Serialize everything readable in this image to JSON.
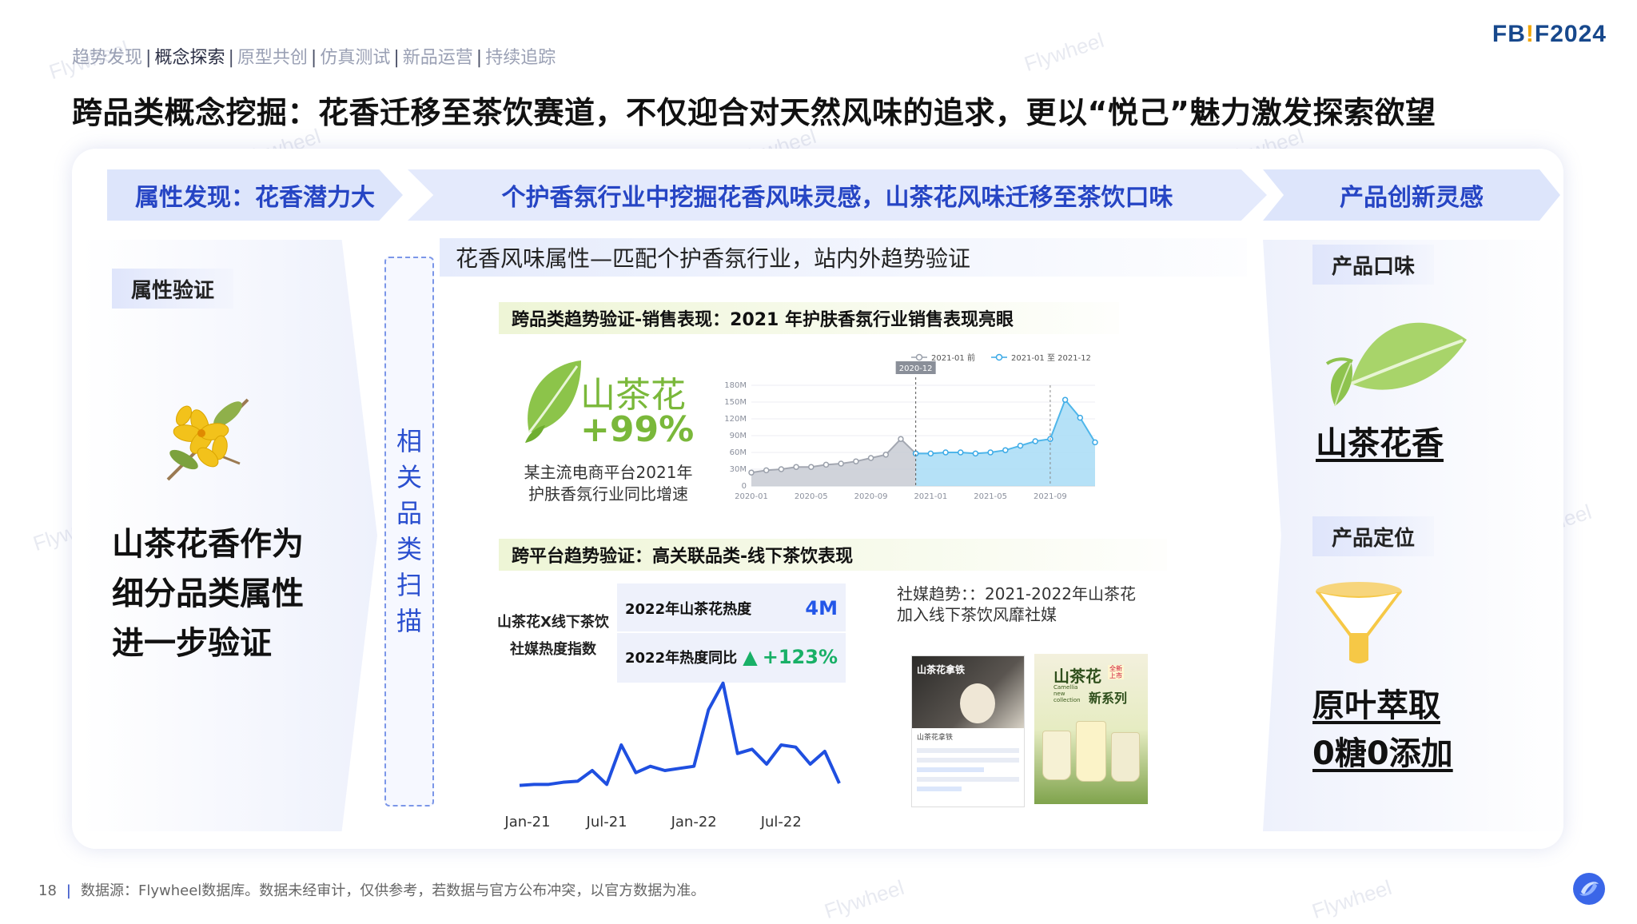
{
  "nav": {
    "items": [
      "趋势发现",
      "概念探索",
      "原型共创",
      "仿真测试",
      "新品运营",
      "持续追踪"
    ],
    "active_index": 1,
    "separator": "|"
  },
  "logo": {
    "part1": "FB",
    "part2": "!",
    "part3": "F2024"
  },
  "title": "跨品类概念挖掘：花香迁移至茶饮赛道，不仅迎合对天然风味的追求，更以“悦己”魅力激发探索欲望",
  "chevrons": {
    "left": "属性发现：花香潜力大",
    "middle": "个护香氛行业中挖掘花香风味灵感，山茶花风味迁移至茶饮口味",
    "right": "产品创新灵感"
  },
  "left": {
    "tag": "属性验证",
    "text_lines": [
      "山茶花香作为",
      "细分品类属性",
      "进一步验证"
    ]
  },
  "scan": {
    "chars": [
      "相",
      "关",
      "品",
      "类",
      "扫",
      "描"
    ]
  },
  "middle": {
    "flavor_title": "花香风味属性—匹配个护香氛行业，站内外趋势验证",
    "sales_title": "跨品类趋势验证-销售表现：2021 年护肤香氛行业销售表现亮眼",
    "flower_name": "山茶花",
    "growth": "+99%",
    "growth_note_lines": [
      "某主流电商平台2021年",
      "护肤香氛行业同比增速"
    ],
    "platform_title": "跨平台趋势验证：高关联品类-线下茶饮表现",
    "index_label_lines": [
      "山茶花X线下茶饮",
      "社媒热度指数"
    ],
    "kpi": [
      {
        "label": "2022年山茶花热度",
        "value": "4M"
      },
      {
        "label": "2022年热度同比",
        "value": "+123%",
        "arrow": "▲"
      }
    ],
    "social_note_lines": [
      "社媒趋势：：2021-2022年山茶花",
      "加入线下茶饮风靡社媒"
    ],
    "img1": {
      "title": "山茶花拿铁",
      "caption": "山茶花拿铁"
    },
    "img2": {
      "title": "山茶花",
      "sub": "新系列",
      "badge": "全新上市",
      "en": "Camellia new collection"
    }
  },
  "right": {
    "tag1": "产品口味",
    "big1": "山茶花香",
    "tag2": "产品定位",
    "big2_lines": [
      "原叶萃取",
      "0糖0添加"
    ]
  },
  "footer": {
    "page": "18",
    "source": "数据源：Flywheel数据库。数据未经审计，仅供参考，若数据与官方公布冲突，以官方数据为准。"
  },
  "watermark": "Flywheel",
  "colors": {
    "accent_blue": "#2645c4",
    "chevron_bg": "#dde5fb",
    "green": "#7ab83a",
    "line_blue": "#1f4fe0",
    "area_gray": "#c8cbd3",
    "area_blue": "#a8dcf6",
    "kpi_up": "#19b067"
  },
  "chart_data": [
    {
      "type": "area",
      "title": "",
      "legend": [
        "2021-01 前",
        "2021-01 至 2021-12"
      ],
      "legend_position": "top-right",
      "marker_label": "2020-12",
      "x_ticks": [
        "2020-01",
        "2020-05",
        "2020-09",
        "2021-01",
        "2021-05",
        "2021-09"
      ],
      "y_ticks": [
        "0",
        "30M",
        "60M",
        "90M",
        "120M",
        "150M",
        "180M"
      ],
      "ylim": [
        0,
        180
      ],
      "unit": "M",
      "series": [
        {
          "name": "2021-01 前",
          "x": [
            "2020-01",
            "2020-02",
            "2020-03",
            "2020-04",
            "2020-05",
            "2020-06",
            "2020-07",
            "2020-08",
            "2020-09",
            "2020-10",
            "2020-11",
            "2020-12"
          ],
          "values": [
            24,
            28,
            30,
            34,
            34,
            38,
            40,
            44,
            50,
            56,
            84,
            58
          ]
        },
        {
          "name": "2021-01 至 2021-12",
          "x": [
            "2020-12",
            "2021-01",
            "2021-02",
            "2021-03",
            "2021-04",
            "2021-05",
            "2021-06",
            "2021-07",
            "2021-08",
            "2021-09",
            "2021-10",
            "2021-11",
            "2021-12"
          ],
          "values": [
            58,
            58,
            60,
            60,
            58,
            60,
            64,
            72,
            80,
            84,
            154,
            122,
            78
          ]
        }
      ]
    },
    {
      "type": "line",
      "title": "",
      "x_ticks": [
        "Jan-21",
        "Jul-21",
        "Jan-22",
        "Jul-22"
      ],
      "series": [
        {
          "name": "",
          "values": [
            4,
            5,
            5,
            7,
            8,
            18,
            5,
            42,
            16,
            22,
            18,
            20,
            22,
            75,
            100,
            34,
            38,
            24,
            42,
            40,
            24,
            36,
            6
          ]
        }
      ],
      "ylim": [
        0,
        105
      ]
    }
  ]
}
